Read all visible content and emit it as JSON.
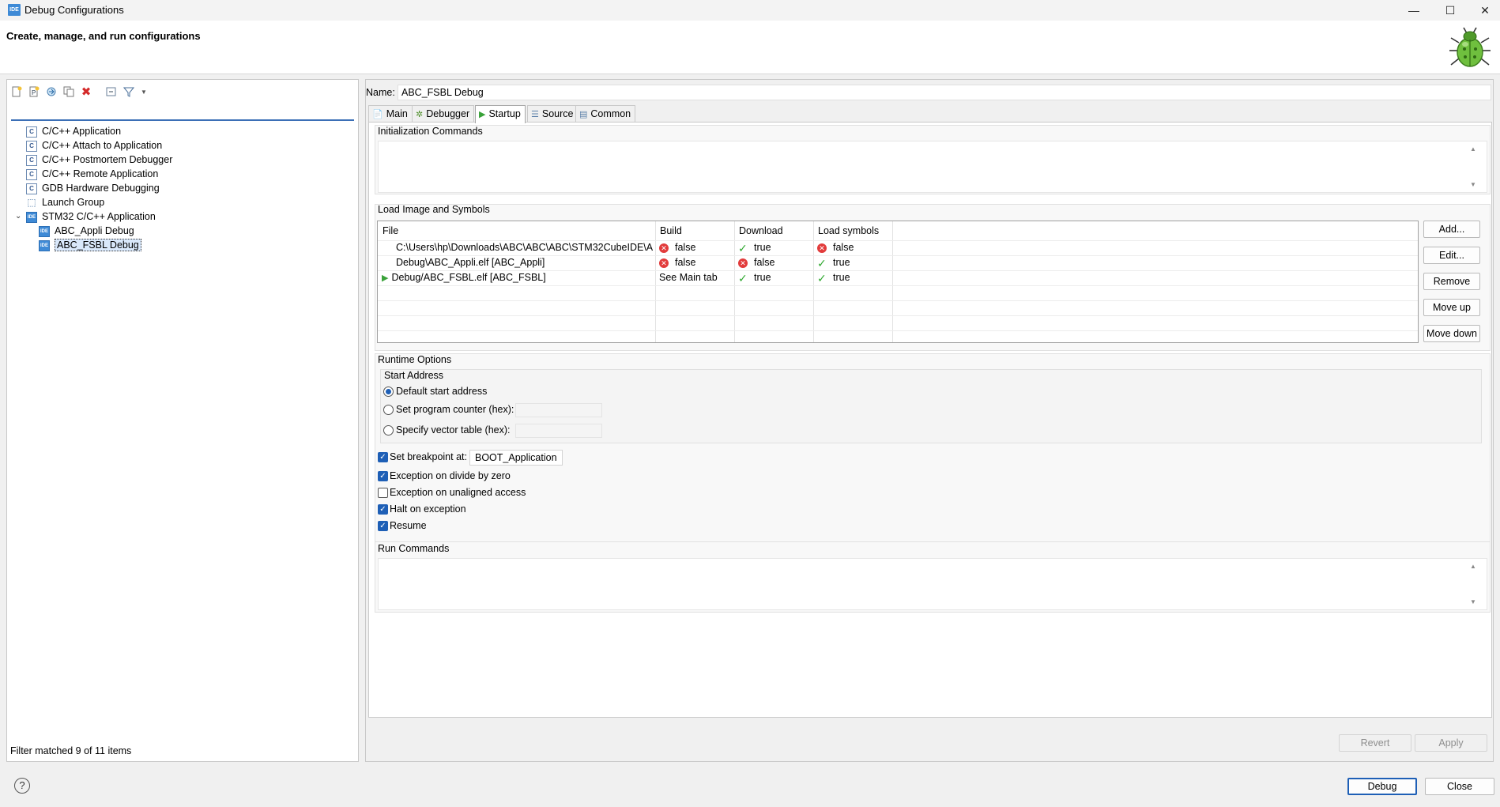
{
  "window": {
    "title": "Debug Configurations",
    "app_icon": "IDE",
    "minimize": "—",
    "maximize": "☐",
    "close": "✕"
  },
  "header": {
    "subtitle": "Create, manage, and run configurations",
    "logo": "bug-icon"
  },
  "left_toolbar": {
    "icons": [
      "new-config-icon",
      "new-prototype-icon",
      "export-icon",
      "duplicate-icon",
      "delete-icon",
      "collapse-all-icon",
      "filter-icon",
      "dropdown-arrow-icon"
    ]
  },
  "filter": {
    "value": "",
    "placeholder": ""
  },
  "tree": [
    {
      "label": "C/C++ Application",
      "icon": "C"
    },
    {
      "label": "C/C++ Attach to Application",
      "icon": "C"
    },
    {
      "label": "C/C++ Postmortem Debugger",
      "icon": "C"
    },
    {
      "label": "C/C++ Remote Application",
      "icon": "C"
    },
    {
      "label": "GDB Hardware Debugging",
      "icon": "C"
    },
    {
      "label": "Launch Group",
      "icon": "launch"
    },
    {
      "label": "STM32 C/C++ Application",
      "icon": "IDE",
      "expanded": true
    },
    {
      "label": "ABC_Appli Debug",
      "icon": "IDE"
    },
    {
      "label": "ABC_FSBL Debug",
      "icon": "IDE",
      "selected": true
    }
  ],
  "filter_status": "Filter matched 9 of 11 items",
  "name": {
    "label": "Name:",
    "value": "ABC_FSBL Debug"
  },
  "tabs": [
    {
      "label": "Main",
      "icon": "main-tab-icon"
    },
    {
      "label": "Debugger",
      "icon": "debugger-tab-icon"
    },
    {
      "label": "Startup",
      "icon": "startup-tab-icon",
      "active": true
    },
    {
      "label": "Source",
      "icon": "source-tab-icon"
    },
    {
      "label": "Common",
      "icon": "common-tab-icon"
    }
  ],
  "init_commands": {
    "label": "Initialization Commands",
    "value": ""
  },
  "load_image": {
    "label": "Load Image and Symbols",
    "columns": [
      "File",
      "Build",
      "Download",
      "Load symbols"
    ],
    "rows": [
      {
        "file": "C:\\Users\\hp\\Downloads\\ABC\\ABC\\ABC\\STM32CubeIDE\\A...",
        "build": "false",
        "build_ok": false,
        "download": "true",
        "download_ok": true,
        "symbols": "false",
        "symbols_ok": false,
        "active": false
      },
      {
        "file": "Debug\\ABC_Appli.elf [ABC_Appli]",
        "build": "false",
        "build_ok": false,
        "download": "false",
        "download_ok": false,
        "symbols": "true",
        "symbols_ok": true,
        "active": false
      },
      {
        "file": "Debug/ABC_FSBL.elf [ABC_FSBL]",
        "build": "See Main tab",
        "build_ok": null,
        "download": "true",
        "download_ok": true,
        "symbols": "true",
        "symbols_ok": true,
        "active": true
      }
    ],
    "buttons": [
      "Add...",
      "Edit...",
      "Remove",
      "Move up",
      "Move down"
    ]
  },
  "runtime": {
    "label": "Runtime Options",
    "start_address": {
      "label": "Start Address",
      "options": [
        {
          "label": "Default start address",
          "checked": true
        },
        {
          "label": "Set program counter (hex):",
          "checked": false
        },
        {
          "label": "Specify vector table (hex):",
          "checked": false
        }
      ]
    },
    "checks": [
      {
        "label": "Set breakpoint at:",
        "checked": true,
        "value": "BOOT_Application"
      },
      {
        "label": "Exception on divide by zero",
        "checked": true
      },
      {
        "label": "Exception on unaligned access",
        "checked": false
      },
      {
        "label": "Halt on exception",
        "checked": true
      },
      {
        "label": "Resume",
        "checked": true
      }
    ]
  },
  "run_commands": {
    "label": "Run Commands",
    "value": ""
  },
  "bottom_buttons": {
    "revert": "Revert",
    "apply": "Apply"
  },
  "footer_buttons": {
    "debug": "Debug",
    "close": "Close",
    "help": "?"
  }
}
